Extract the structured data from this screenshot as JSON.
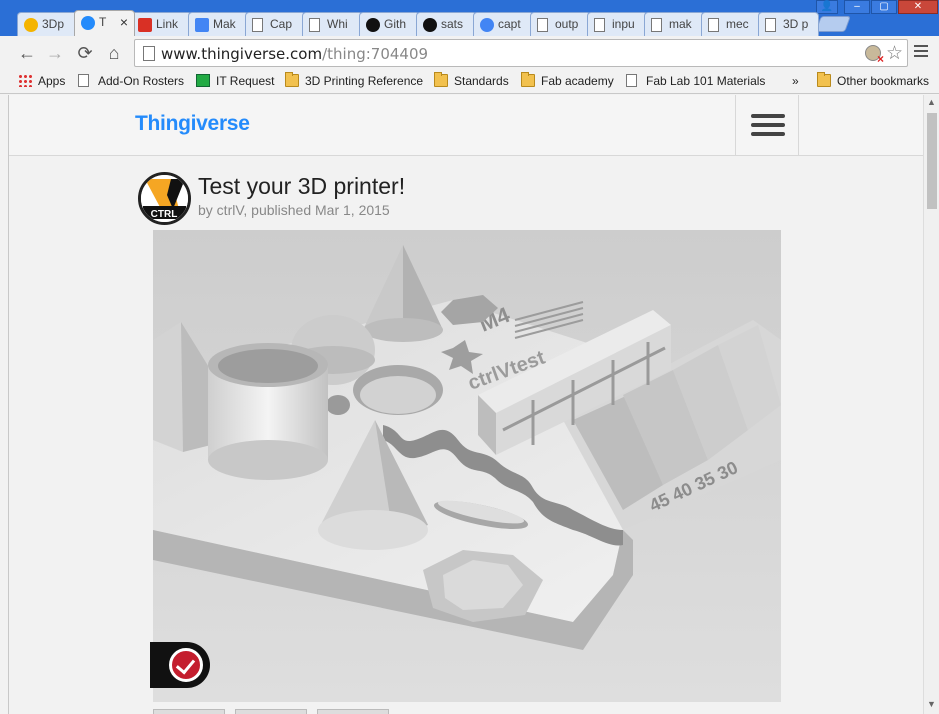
{
  "browser": {
    "tabs": [
      {
        "label": "3Dp",
        "icon": "google-drive-icon",
        "color": "#f4b400"
      },
      {
        "label": "T",
        "icon": "thingiverse-icon",
        "color": "#248bfb",
        "active": true
      },
      {
        "label": "Link",
        "icon": "gmail-icon",
        "color": "#d93025"
      },
      {
        "label": "Mak",
        "icon": "docs-icon",
        "color": "#4285f4"
      },
      {
        "label": "Cap",
        "icon": "page-icon",
        "color": "#777"
      },
      {
        "label": "Whi",
        "icon": "page-icon",
        "color": "#777"
      },
      {
        "label": "Gith",
        "icon": "github-icon",
        "color": "#111"
      },
      {
        "label": "sats",
        "icon": "github-icon",
        "color": "#111"
      },
      {
        "label": "capt",
        "icon": "google-icon",
        "color": "#4285f4"
      },
      {
        "label": "outp",
        "icon": "page-icon",
        "color": "#777"
      },
      {
        "label": "inpu",
        "icon": "page-icon",
        "color": "#777"
      },
      {
        "label": "mak",
        "icon": "page-icon",
        "color": "#777"
      },
      {
        "label": "mec",
        "icon": "page-icon",
        "color": "#777"
      },
      {
        "label": "3D p",
        "icon": "page-icon",
        "color": "#777"
      }
    ],
    "tab_close": "×",
    "url_host": "www.thingiverse.com",
    "url_path": "/thing:704409",
    "nav": {
      "back": "←",
      "forward": "→",
      "reload": "⟳",
      "home": "⌂"
    },
    "bookmarks": [
      {
        "label": "Apps",
        "type": "apps"
      },
      {
        "label": "Add-On Rosters",
        "type": "doc"
      },
      {
        "label": "IT Request",
        "type": "site"
      },
      {
        "label": "3D Printing Reference",
        "type": "folder"
      },
      {
        "label": "Standards",
        "type": "folder"
      },
      {
        "label": "Fab academy",
        "type": "folder"
      },
      {
        "label": "Fab Lab 101 Materials",
        "type": "doc"
      }
    ],
    "bookmarks_overflow": "»",
    "other_bookmarks": "Other bookmarks"
  },
  "site": {
    "logo": "Thingiverse",
    "accent": "#248bfb"
  },
  "thing": {
    "title": "Test your 3D printer!",
    "byline": "by ctrlV, published Mar 1, 2015",
    "avatar_text": "CTRL",
    "render_labels": {
      "m4": "M4",
      "ctrlv": "ctrlVtest",
      "angles": "45 40 35 30"
    }
  }
}
